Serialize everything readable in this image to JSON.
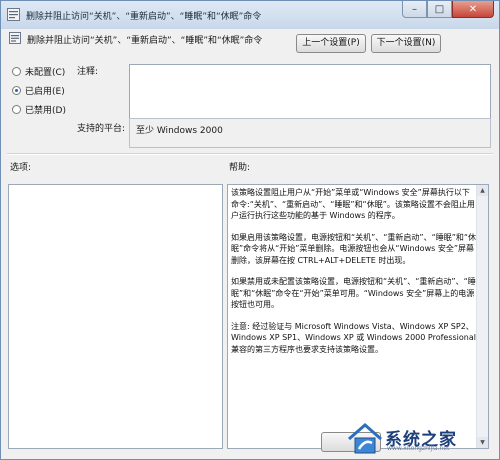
{
  "window": {
    "title": "删除并阻止访问“关机”、“重新启动”、“睡眠”和“休眠”命令",
    "close_symbol": "✕",
    "maximize_symbol": "□",
    "minimize_symbol": "–"
  },
  "header": {
    "title": "删除并阻止访问“关机”、“重新启动”、“睡眠”和“休眠”命令",
    "icon": "policy-setting-icon",
    "prev_button": "上一个设置(P)",
    "next_button": "下一个设置(N)"
  },
  "state": {
    "options": [
      {
        "label": "未配置(C)",
        "checked": false
      },
      {
        "label": "已启用(E)",
        "checked": true
      },
      {
        "label": "已禁用(D)",
        "checked": false
      }
    ]
  },
  "comment": {
    "label": "注释:",
    "value": ""
  },
  "platform": {
    "label": "支持的平台:",
    "value": "至少 Windows 2000"
  },
  "options_section": {
    "label": "选项:"
  },
  "help_section": {
    "label": "帮助:",
    "paragraphs": [
      "该策略设置阻止用户从“开始”菜单或“Windows 安全”屏幕执行以下命令:“关机”、“重新启动”、“睡眠”和“休眠”。该策略设置不会阻止用户运行执行这些功能的基于 Windows 的程序。",
      "如果启用该策略设置，电源按钮和“关机”、“重新启动”、“睡眠”和“休眠”命令将从“开始”菜单删除。电源按钮也会从“Windows 安全”屏幕删除，该屏幕在按 CTRL+ALT+DELETE 时出现。",
      "如果禁用或未配置该策略设置，电源按钮和“关机”、“重新启动”、“睡眠”和“休眠”命令在“开始”菜单可用。“Windows 安全”屏幕上的电源按钮也可用。",
      "注意: 经过验证与 Microsoft Windows Vista、Windows XP SP2、Windows XP SP1、Windows XP 或 Windows 2000 Professional 兼容的第三方程序也要求支持该策略设置。"
    ]
  },
  "watermark": {
    "text": "系统之家",
    "url": "www.xitongzhijia.net"
  },
  "colors": {
    "title_bar": "#c8d8ea",
    "close_button": "#c6453a",
    "radio_dot": "#2a62b8",
    "watermark_text": "#1d3f7a"
  }
}
